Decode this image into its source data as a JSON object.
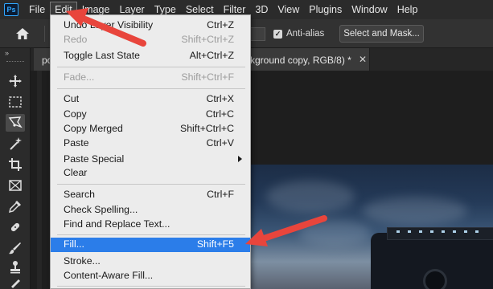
{
  "app": {
    "logo_text": "Ps"
  },
  "menubar": {
    "items": [
      "File",
      "Edit",
      "Image",
      "Layer",
      "Type",
      "Select",
      "Filter",
      "3D",
      "View",
      "Plugins",
      "Window",
      "Help"
    ],
    "active": "Edit"
  },
  "options": {
    "anti_alias_label": "Anti-alias",
    "anti_alias_checked": true,
    "select_mask_label": "Select and Mask..."
  },
  "toolbar": {
    "collapse_glyph": "»",
    "tools": [
      "move-tool",
      "marquee-tool",
      "lasso-tool",
      "magic-wand-tool",
      "crop-tool",
      "frame-tool",
      "eyedropper-tool",
      "healing-brush-tool",
      "brush-tool",
      "clone-stamp-tool",
      "history-brush-tool"
    ],
    "selected_tool": "lasso-tool"
  },
  "tabs": {
    "left_label": "po",
    "active_label": "kground copy, RGB/8) *",
    "close_glyph": "✕"
  },
  "edit_menu": {
    "items": [
      {
        "label": "Undo Layer Visibility",
        "shortcut": "Ctrl+Z",
        "state": "normal"
      },
      {
        "label": "Redo",
        "shortcut": "Shift+Ctrl+Z",
        "state": "disabled"
      },
      {
        "label": "Toggle Last State",
        "shortcut": "Alt+Ctrl+Z",
        "state": "normal"
      },
      {
        "label": "Fade...",
        "shortcut": "Shift+Ctrl+F",
        "state": "disabled"
      },
      {
        "label": "Cut",
        "shortcut": "Ctrl+X",
        "state": "normal"
      },
      {
        "label": "Copy",
        "shortcut": "Ctrl+C",
        "state": "normal"
      },
      {
        "label": "Copy Merged",
        "shortcut": "Shift+Ctrl+C",
        "state": "normal"
      },
      {
        "label": "Paste",
        "shortcut": "Ctrl+V",
        "state": "normal"
      },
      {
        "label": "Paste Special",
        "shortcut": "",
        "state": "submenu"
      },
      {
        "label": "Clear",
        "shortcut": "",
        "state": "normal"
      },
      {
        "label": "Search",
        "shortcut": "Ctrl+F",
        "state": "normal"
      },
      {
        "label": "Check Spelling...",
        "shortcut": "",
        "state": "normal"
      },
      {
        "label": "Find and Replace Text...",
        "shortcut": "",
        "state": "normal"
      },
      {
        "label": "Fill...",
        "shortcut": "Shift+F5",
        "state": "highlighted"
      },
      {
        "label": "Stroke...",
        "shortcut": "",
        "state": "normal"
      },
      {
        "label": "Content-Aware Fill...",
        "shortcut": "",
        "state": "normal"
      }
    ]
  },
  "colors": {
    "menu_highlight": "#2b7de9",
    "annotation_arrow": "#e8453c",
    "photoshop_blue": "#31a8ff"
  }
}
